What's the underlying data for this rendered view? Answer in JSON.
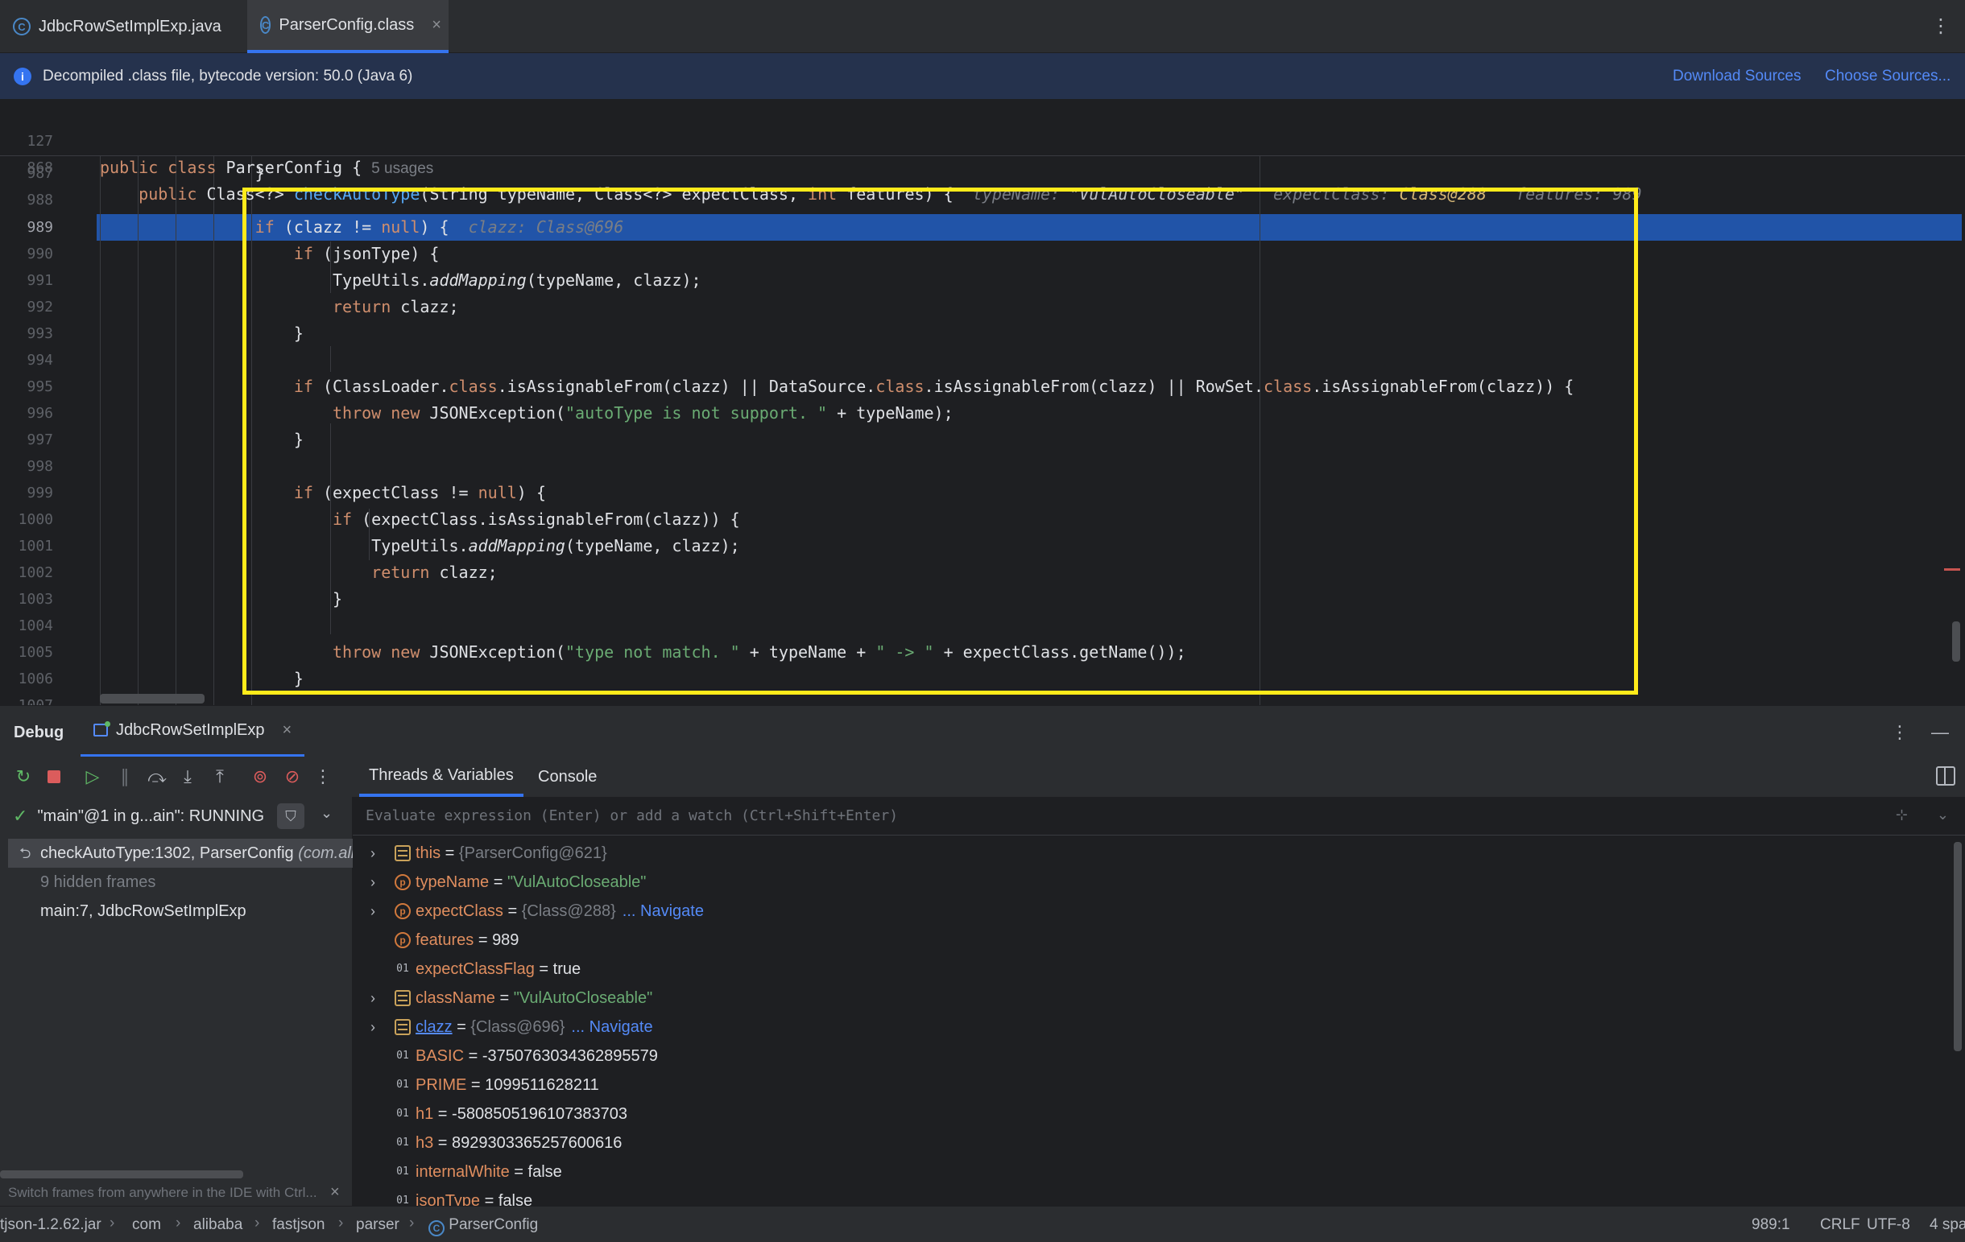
{
  "tabs": [
    {
      "label": "JdbcRowSetImplExp.java",
      "icon": "java-class-icon"
    },
    {
      "label": "ParserConfig.class",
      "icon": "class-file-icon",
      "close": "×"
    }
  ],
  "banner": {
    "text": "Decompiled .class file, bytecode version: 50.0 (Java 6)",
    "download_sources": "Download Sources",
    "choose_sources": "Choose Sources..."
  },
  "editor": {
    "sticky_127_ln": "127",
    "sticky_868_ln": "868",
    "class_usages": "5 usages",
    "hint_typeName_label": "typeName:",
    "hint_typeName_value": "\"VulAutoCloseable\"",
    "hint_expectClass_label": "expectClass:",
    "hint_expectClass_value": "Class@288",
    "hint_features": "features: 989",
    "hint_clazz": "clazz: Class@696",
    "current_line": "989",
    "line_numbers": [
      "987",
      "988",
      "989",
      "990",
      "991",
      "992",
      "993",
      "994",
      "995",
      "996",
      "997",
      "998",
      "999",
      "1000",
      "1001",
      "1002",
      "1003",
      "1004",
      "1005",
      "1006",
      "1007"
    ]
  },
  "debug": {
    "title": "Debug",
    "session_tab": "JdbcRowSetImplExp",
    "close": "×",
    "inner_tabs": [
      "Threads & Variables",
      "Console"
    ],
    "thread": "\"main\"@1 in g...ain\": RUNNING",
    "frames": [
      {
        "label": "checkAutoType:1302, ParserConfig",
        "pkg": "(com.alib"
      },
      {
        "label": "9 hidden frames"
      },
      {
        "label": "main:7, JdbcRowSetImplExp"
      }
    ],
    "frames_hint": "Switch frames from anywhere in the IDE with Ctrl...",
    "eval_placeholder": "Evaluate expression (Enter) or add a watch (Ctrl+Shift+Enter)",
    "variables": [
      {
        "name": "this",
        "eq": " = ",
        "value": "{ParserConfig@621}",
        "kind": "field",
        "expandable": true
      },
      {
        "name": "typeName",
        "eq": " = ",
        "value": "\"VulAutoCloseable\"",
        "kind": "param",
        "expandable": true,
        "str": true
      },
      {
        "name": "expectClass",
        "eq": " = ",
        "value": "{Class@288}",
        "nav": "... Navigate",
        "kind": "param",
        "expandable": true
      },
      {
        "name": "features",
        "eq": " = ",
        "value": "989",
        "kind": "param",
        "expandable": false
      },
      {
        "name": "expectClassFlag",
        "eq": " = ",
        "value": "true",
        "kind": "prim",
        "expandable": false
      },
      {
        "name": "className",
        "eq": " = ",
        "value": "\"VulAutoCloseable\"",
        "kind": "field",
        "expandable": true,
        "str": true
      },
      {
        "name": "clazz",
        "eq": " = ",
        "value": "{Class@696}",
        "nav": "... Navigate",
        "kind": "field",
        "expandable": true,
        "link": true
      },
      {
        "name": "BASIC",
        "eq": " = ",
        "value": "-3750763034362895579",
        "kind": "prim",
        "expandable": false
      },
      {
        "name": "PRIME",
        "eq": " = ",
        "value": "1099511628211",
        "kind": "prim",
        "expandable": false
      },
      {
        "name": "h1",
        "eq": " = ",
        "value": "-5808505196107383703",
        "kind": "prim",
        "expandable": false
      },
      {
        "name": "h3",
        "eq": " = ",
        "value": "8929303365257600616",
        "kind": "prim",
        "expandable": false
      },
      {
        "name": "internalWhite",
        "eq": " = ",
        "value": "false",
        "kind": "prim",
        "expandable": false
      },
      {
        "name": "jsonType",
        "eq": " = ",
        "value": "false",
        "kind": "prim",
        "expandable": false
      }
    ]
  },
  "statusbar": {
    "crumbs": [
      "tjson-1.2.62.jar",
      "com",
      "alibaba",
      "fastjson",
      "parser",
      "ParserConfig"
    ],
    "position": "989:1",
    "line_ending": "CRLF",
    "encoding": "UTF-8",
    "indent": "4 spa"
  }
}
